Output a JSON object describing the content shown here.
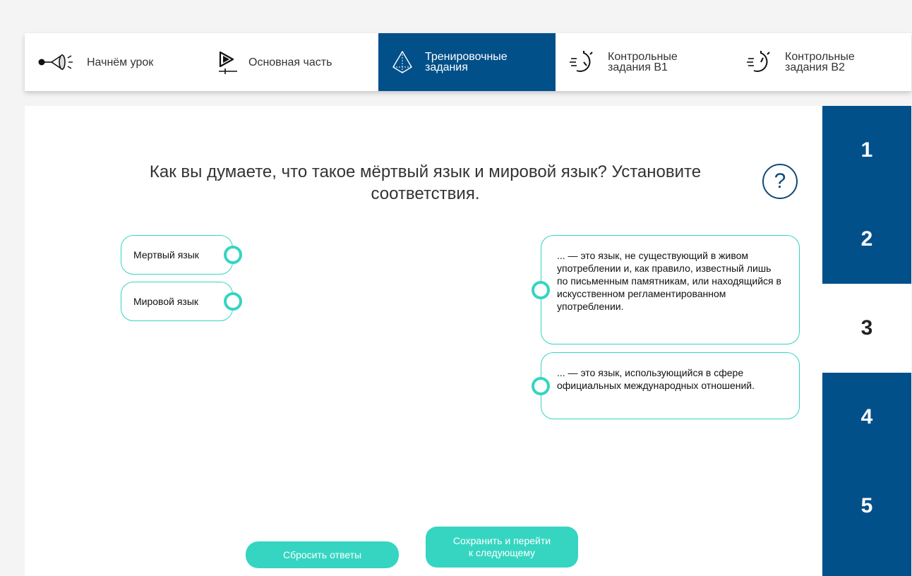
{
  "nav": {
    "tabs": [
      {
        "label": "Начнём урок",
        "icon": "megaphone-icon"
      },
      {
        "label": "Основная часть",
        "icon": "play-icon"
      },
      {
        "label": "Тренировочные\nзадания",
        "icon": "pyramid-icon",
        "active": true
      },
      {
        "label": "Контрольные\nзадания В1",
        "icon": "stopwatch-icon"
      },
      {
        "label": "Контрольные\nзадания В2",
        "icon": "stopwatch-icon"
      }
    ]
  },
  "question": {
    "text": "Как вы думаете, что такое мёртвый язык и мировой язык? Установите соответствия.",
    "help": "?"
  },
  "terms": [
    {
      "label": "Мертвый язык"
    },
    {
      "label": "Мировой язык"
    }
  ],
  "definitions": [
    {
      "text": "... — это язык, не существующий в живом употреблении и, как правило, известный лишь по письменным памятникам, или находящийся в искусственном регламентированном употреблении."
    },
    {
      "text": "... — это язык, использующийся в сфере официальных международных отношений."
    }
  ],
  "buttons": {
    "reset": "Сбросить ответы",
    "save": "Сохранить и перейти\nк следующему"
  },
  "steps": {
    "items": [
      "1",
      "2",
      "3",
      "4",
      "5"
    ],
    "active": "3"
  },
  "colors": {
    "primary": "#02508a",
    "accent": "#35d5c1"
  }
}
